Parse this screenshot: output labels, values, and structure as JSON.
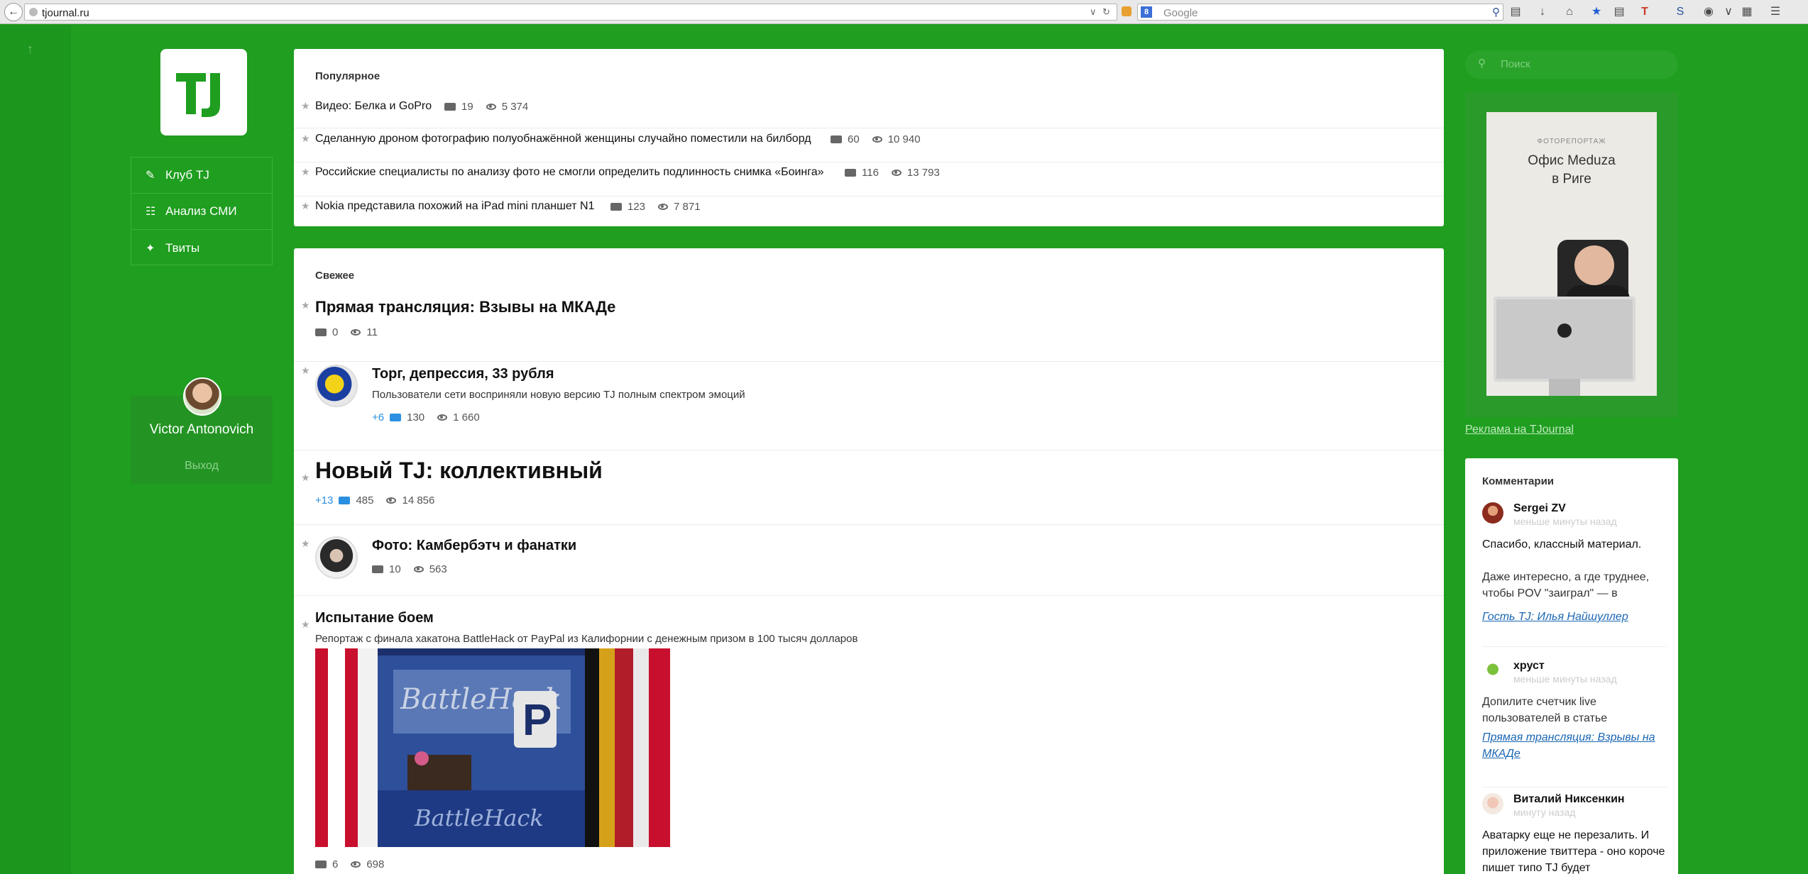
{
  "browser": {
    "url": "tjournal.ru",
    "search_engine_letter": "8",
    "search_placeholder": "Google"
  },
  "nav": {
    "items": [
      {
        "label": "Клуб TJ",
        "icon": "pencil-icon"
      },
      {
        "label": "Анализ СМИ",
        "icon": "book-icon"
      },
      {
        "label": "Твиты",
        "icon": "twitter-icon"
      }
    ]
  },
  "user": {
    "name": "Victor Antonovich",
    "logout": "Выход"
  },
  "popular": {
    "title": "Популярное",
    "items": [
      {
        "title": "Видео: Белка и GoPro",
        "comments": "19",
        "views": "5 374"
      },
      {
        "title": "Сделанную дроном фотографию полуобнажённой женщины случайно поместили на билборд",
        "comments": "60",
        "views": "10 940"
      },
      {
        "title": "Российские специалисты по анализу фото не смогли определить подлинность снимка «Боинга»",
        "comments": "116",
        "views": "13 793"
      },
      {
        "title": "Nokia представила похожий на iPad mini планшет N1",
        "comments": "123",
        "views": "7 871"
      }
    ]
  },
  "fresh": {
    "title": "Свежее",
    "items": [
      {
        "title": "Прямая трансляция: Взывы на МКАДе",
        "comments": "0",
        "views": "11"
      },
      {
        "title": "Торг, депрессия, 33 рубля",
        "subtitle": "Пользователи сети восприняли новую версию TJ полным спектром эмоций",
        "plus": "+6",
        "comments": "130",
        "views": "1 660"
      },
      {
        "title": "Новый TJ: коллективный",
        "plus": "+13",
        "comments": "485",
        "views": "14 856"
      },
      {
        "title": "Фото: Камбербэтч и фанатки",
        "comments": "10",
        "views": "563"
      },
      {
        "title": "Испытание боем",
        "subtitle": "Репортаж с финала хакатона BattleHack от PayPal из Калифорнии с денежным призом в 100 тысяч долларов",
        "comments": "6",
        "views": "698"
      }
    ]
  },
  "right": {
    "search_placeholder": "Поиск",
    "ad": {
      "kicker": "ФОТОРЕПОРТАЖ",
      "title_line1": "Офис Meduza",
      "title_line2": "в Риге"
    },
    "ad_link": "Реклама на TJournal"
  },
  "comments": {
    "title": "Комментарии",
    "items": [
      {
        "author": "Sergei ZV",
        "time": "меньше минуты назад",
        "text": "Спасибо, классный материал.",
        "text2": "Даже интересно, а где труднее, чтобы POV \"заиграл\" — в",
        "link": "Гость TJ: Илья Найшуллер"
      },
      {
        "author": "хруст",
        "time": "меньше минуты назад",
        "text": "Допилите счетчик live пользователей в статье",
        "link": "Прямая трансляция: Взрывы на МКАДе"
      },
      {
        "author": "Виталий Никсенкин",
        "time": "минуту назад",
        "text": "Аватарку еще не перезалить. И приложение твиттера - оно короче пишет типо TJ будет"
      }
    ]
  },
  "colors": {
    "page_green": "#1f9e1f",
    "link_blue": "#1a66b3",
    "plus_blue": "#2a8fe0"
  }
}
